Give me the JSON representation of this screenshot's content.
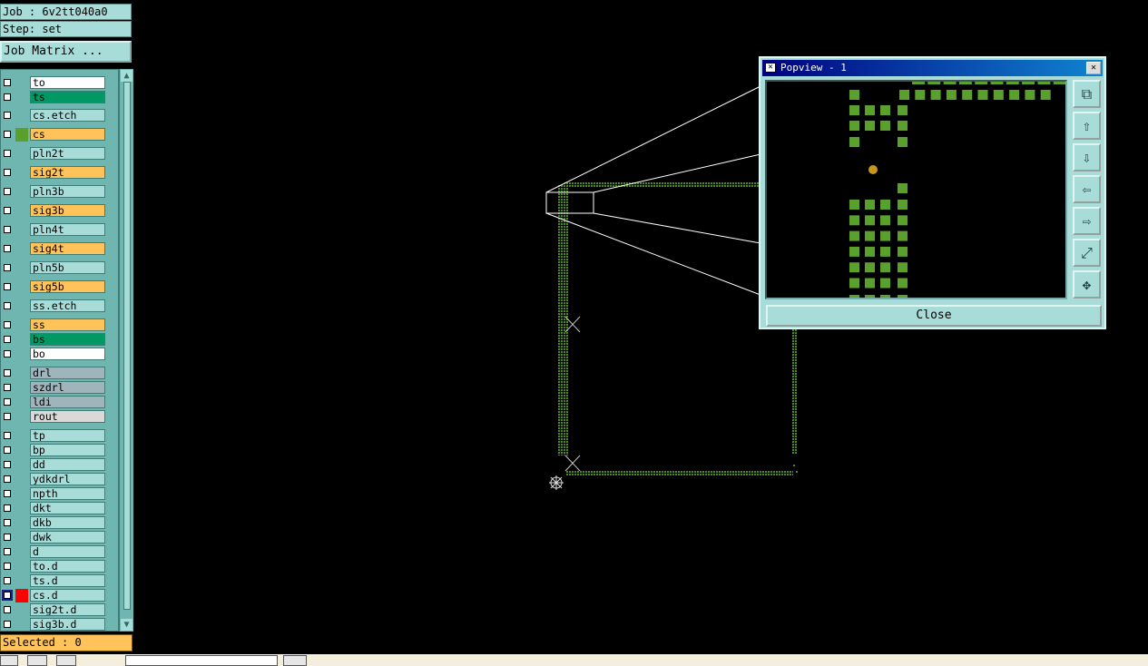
{
  "job_label": "Job : 6v2tt040a0",
  "step_label": "Step: set",
  "job_matrix_button": "Job Matrix ...",
  "layers": [
    {
      "name": "to",
      "name_bg": "#ffffff",
      "swatch": ""
    },
    {
      "name": "ts",
      "name_bg": "#009966",
      "swatch": ""
    },
    {
      "name": "cs.etch",
      "name_bg": "#a8dcd9",
      "swatch": ""
    },
    {
      "name": "cs",
      "name_bg": "#ffc35a",
      "swatch": "#5aa02c"
    },
    {
      "name": "pln2t",
      "name_bg": "#a8dcd9",
      "swatch": ""
    },
    {
      "name": "sig2t",
      "name_bg": "#ffc35a",
      "swatch": ""
    },
    {
      "name": "pln3b",
      "name_bg": "#a8dcd9",
      "swatch": ""
    },
    {
      "name": "sig3b",
      "name_bg": "#ffc35a",
      "swatch": ""
    },
    {
      "name": "pln4t",
      "name_bg": "#a8dcd9",
      "swatch": ""
    },
    {
      "name": "sig4t",
      "name_bg": "#ffc35a",
      "swatch": ""
    },
    {
      "name": "pln5b",
      "name_bg": "#a8dcd9",
      "swatch": ""
    },
    {
      "name": "sig5b",
      "name_bg": "#ffc35a",
      "swatch": ""
    },
    {
      "name": "ss.etch",
      "name_bg": "#a8dcd9",
      "swatch": ""
    },
    {
      "name": "ss",
      "name_bg": "#ffc35a",
      "swatch": ""
    },
    {
      "name": "bs",
      "name_bg": "#009966",
      "swatch": ""
    },
    {
      "name": "bo",
      "name_bg": "#ffffff",
      "swatch": ""
    },
    {
      "name": "drl",
      "name_bg": "#a0b4bc",
      "swatch": ""
    },
    {
      "name": "szdrl",
      "name_bg": "#a0b4bc",
      "swatch": ""
    },
    {
      "name": "ldi",
      "name_bg": "#a0b4bc",
      "swatch": ""
    },
    {
      "name": "rout",
      "name_bg": "#d9d9d9",
      "swatch": ""
    },
    {
      "name": "tp",
      "name_bg": "#a8dcd9",
      "swatch": ""
    },
    {
      "name": "bp",
      "name_bg": "#a8dcd9",
      "swatch": ""
    },
    {
      "name": "dd",
      "name_bg": "#a8dcd9",
      "swatch": ""
    },
    {
      "name": "ydkdrl",
      "name_bg": "#a8dcd9",
      "swatch": ""
    },
    {
      "name": "npth",
      "name_bg": "#a8dcd9",
      "swatch": ""
    },
    {
      "name": "dkt",
      "name_bg": "#a8dcd9",
      "swatch": ""
    },
    {
      "name": "dkb",
      "name_bg": "#a8dcd9",
      "swatch": ""
    },
    {
      "name": "dwk",
      "name_bg": "#a8dcd9",
      "swatch": ""
    },
    {
      "name": "d",
      "name_bg": "#a8dcd9",
      "swatch": ""
    },
    {
      "name": "to.d",
      "name_bg": "#a8dcd9",
      "swatch": ""
    },
    {
      "name": "ts.d",
      "name_bg": "#a8dcd9",
      "swatch": ""
    },
    {
      "name": "cs.d",
      "name_bg": "#a8dcd9",
      "swatch": "#ff0000",
      "checked": true
    },
    {
      "name": "sig2t.d",
      "name_bg": "#a8dcd9",
      "swatch": ""
    },
    {
      "name": "sig3b.d",
      "name_bg": "#a8dcd9",
      "swatch": ""
    }
  ],
  "selected_label": "Selected : 0",
  "popview": {
    "title": "Popview - 1",
    "close_label": "Close",
    "side_buttons": [
      "zoom-fit-icon",
      "arrow-up-icon",
      "arrow-down-icon",
      "arrow-left-icon",
      "arrow-right-icon",
      "zoom-in-icon",
      "zoom-out-icon"
    ]
  },
  "colors": {
    "feature_green": "#4a8a1c",
    "pad_green": "#5aa02c",
    "hole_yellow": "#c8961e"
  }
}
